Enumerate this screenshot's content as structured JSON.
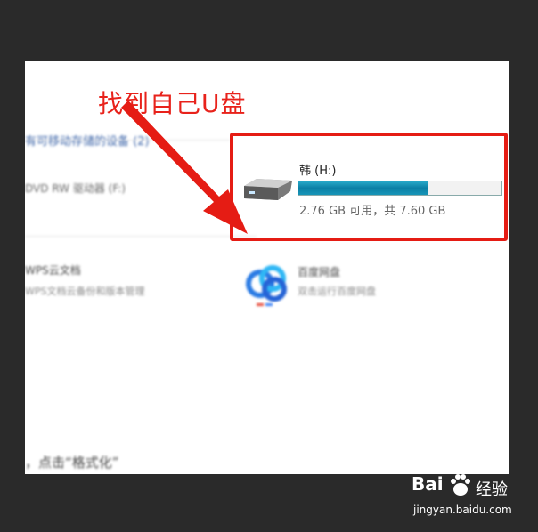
{
  "annotation": {
    "text": "找到自己U盘"
  },
  "background_content": {
    "section_header": "有可移动存储的设备 (2)",
    "dvd_label": "DVD RW 驱动器 (F:)",
    "wps_title": "WPS云文档",
    "wps_subtitle": "WPS文档云备份和版本管理",
    "baidu_title": "百度网盘",
    "baidu_subtitle": "双击运行百度网盘",
    "bottom_instruction": "，点击“格式化”"
  },
  "drive": {
    "name": "韩 (H:)",
    "free_text": "2.76 GB 可用，共 7.60 GB",
    "used_fraction": 0.637,
    "bar_color": "#0a7fa5"
  },
  "colors": {
    "highlight": "#e51c14",
    "annotation": "#e8221b",
    "frame": "#2a2a2a"
  },
  "watermark": {
    "brand": "Bai",
    "paw_icon": "baidu-paw-icon",
    "jingyan": "经验",
    "url": "jingyan.baidu.com"
  }
}
